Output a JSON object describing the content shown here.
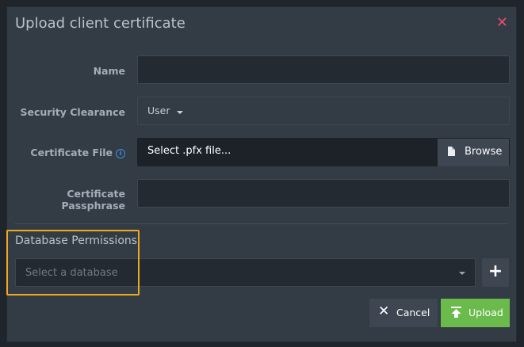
{
  "dialog": {
    "title": "Upload client certificate",
    "close_icon": "close-icon"
  },
  "form": {
    "name_label": "Name",
    "name_value": "",
    "clearance_label": "Security Clearance",
    "clearance_value": "User",
    "cert_file_label": "Certificate File",
    "cert_file_info_icon": "info-icon",
    "cert_file_value": "Select .pfx file...",
    "browse_label": "Browse",
    "browse_icon": "file-icon",
    "passphrase_label": "Certificate Passphrase",
    "passphrase_value": ""
  },
  "permissions": {
    "title": "Database Permissions",
    "database_placeholder": "Select a database",
    "add_icon": "plus-icon"
  },
  "actions": {
    "cancel_label": "Cancel",
    "cancel_icon": "x-icon",
    "upload_label": "Upload",
    "upload_icon": "upload-icon"
  },
  "colors": {
    "close": "#ea4c6b",
    "upload_button": "#6abb4c",
    "highlight": "#f0a81f",
    "info": "#3a8ee6"
  }
}
